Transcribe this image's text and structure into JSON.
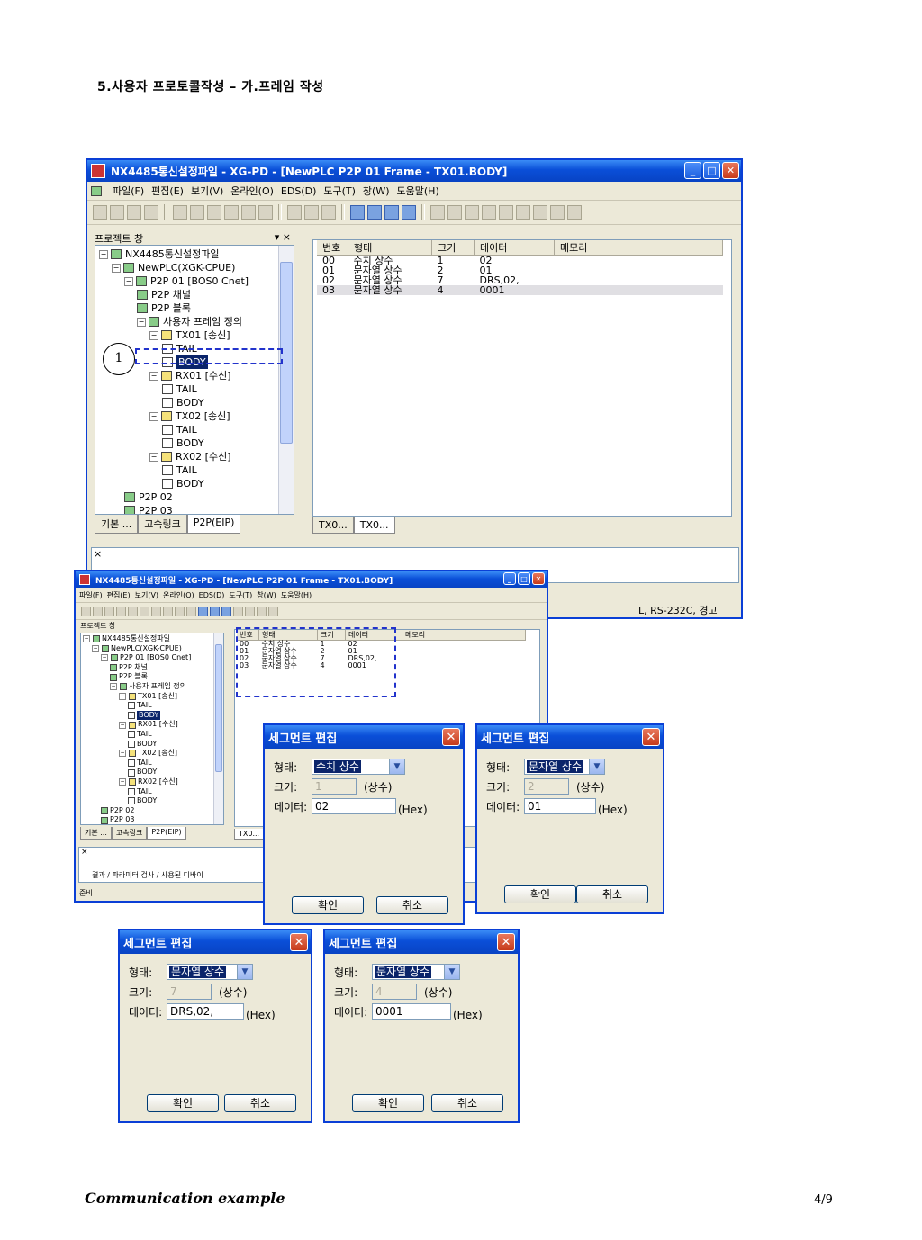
{
  "heading": "5.사용자 프로토콜작성 – 가.프레임 작성",
  "footer": {
    "left": "Communication example",
    "right": "4/9"
  },
  "main_window": {
    "title": "NX4485통신설정파일 - XG-PD - [NewPLC P2P 01 Frame - TX01.BODY]",
    "menu": [
      "파일(F)",
      "편집(E)",
      "보기(V)",
      "온라인(O)",
      "EDS(D)",
      "도구(T)",
      "창(W)",
      "도움말(H)"
    ],
    "project_pane_title": "프로젝트 창",
    "tree": [
      {
        "label": "NX4485통신설정파일",
        "level": 0
      },
      {
        "label": "NewPLC(XGK-CPUE)",
        "level": 1
      },
      {
        "label": "P2P 01 [BOS0 Cnet]",
        "level": 2
      },
      {
        "label": "P2P 채널",
        "level": 3
      },
      {
        "label": "P2P 블록",
        "level": 3
      },
      {
        "label": "사용자 프레임 정의",
        "level": 3
      },
      {
        "label": "TX01 [송신]",
        "level": 4
      },
      {
        "label": "TAIL",
        "level": 5
      },
      {
        "label": "BODY",
        "level": 5,
        "selected": true
      },
      {
        "label": "RX01 [수신]",
        "level": 4
      },
      {
        "label": "TAIL",
        "level": 5
      },
      {
        "label": "BODY",
        "level": 5
      },
      {
        "label": "TX02 [송신]",
        "level": 4
      },
      {
        "label": "TAIL",
        "level": 5
      },
      {
        "label": "BODY",
        "level": 5
      },
      {
        "label": "RX02 [수신]",
        "level": 4
      },
      {
        "label": "TAIL",
        "level": 5
      },
      {
        "label": "BODY",
        "level": 5
      },
      {
        "label": "P2P 02",
        "level": 2
      },
      {
        "label": "P2P 03",
        "level": 2
      }
    ],
    "pane_tabs": [
      "기본 ...",
      "고속링크",
      "P2P(EIP)"
    ],
    "doc_tabs": [
      "TX0...",
      "TX0..."
    ],
    "columns": [
      "번호",
      "형태",
      "크기",
      "데이터",
      "메모리"
    ],
    "rows": [
      {
        "no": "00",
        "type": "수치 상수",
        "size": "1",
        "data": "02"
      },
      {
        "no": "01",
        "type": "문자열 상수",
        "size": "2",
        "data": "01"
      },
      {
        "no": "02",
        "type": "문자열 상수",
        "size": "7",
        "data": "DRS,02,"
      },
      {
        "no": "03",
        "type": "문자열 상수",
        "size": "4",
        "data": "0001"
      }
    ],
    "status_right": "L, RS-232C, 경고",
    "callout": "1"
  },
  "second_window": {
    "title": "NX4485통신설정파일 - XG-PD - [NewPLC P2P 01 Frame - TX01.BODY]",
    "bottom_tabs": "결과 / 파라미터 검사 / 사용된 디바이",
    "status_left": "준비"
  },
  "dialogs": [
    {
      "title": "세그먼트 편집",
      "type_label": "형태:",
      "type_value": "수치 상수",
      "size_label": "크기:",
      "size_value": "1",
      "size_unit": "(상수)",
      "data_label": "데이터:",
      "data_value": "02",
      "data_unit": "(Hex)",
      "ok": "확인",
      "cancel": "취소"
    },
    {
      "title": "세그먼트 편집",
      "type_label": "형태:",
      "type_value": "문자열 상수",
      "size_label": "크기:",
      "size_value": "2",
      "size_unit": "(상수)",
      "data_label": "데이터:",
      "data_value": "01",
      "data_unit": "(Hex)",
      "ok": "확인",
      "cancel": "취소"
    },
    {
      "title": "세그먼트 편집",
      "type_label": "형태:",
      "type_value": "문자열 상수",
      "size_label": "크기:",
      "size_value": "7",
      "size_unit": "(상수)",
      "data_label": "데이터:",
      "data_value": "DRS,02,",
      "data_unit": "(Hex)",
      "ok": "확인",
      "cancel": "취소"
    },
    {
      "title": "세그먼트 편집",
      "type_label": "형태:",
      "type_value": "문자열 상수",
      "size_label": "크기:",
      "size_value": "4",
      "size_unit": "(상수)",
      "data_label": "데이터:",
      "data_value": "0001",
      "data_unit": "(Hex)",
      "ok": "확인",
      "cancel": "취소"
    }
  ]
}
